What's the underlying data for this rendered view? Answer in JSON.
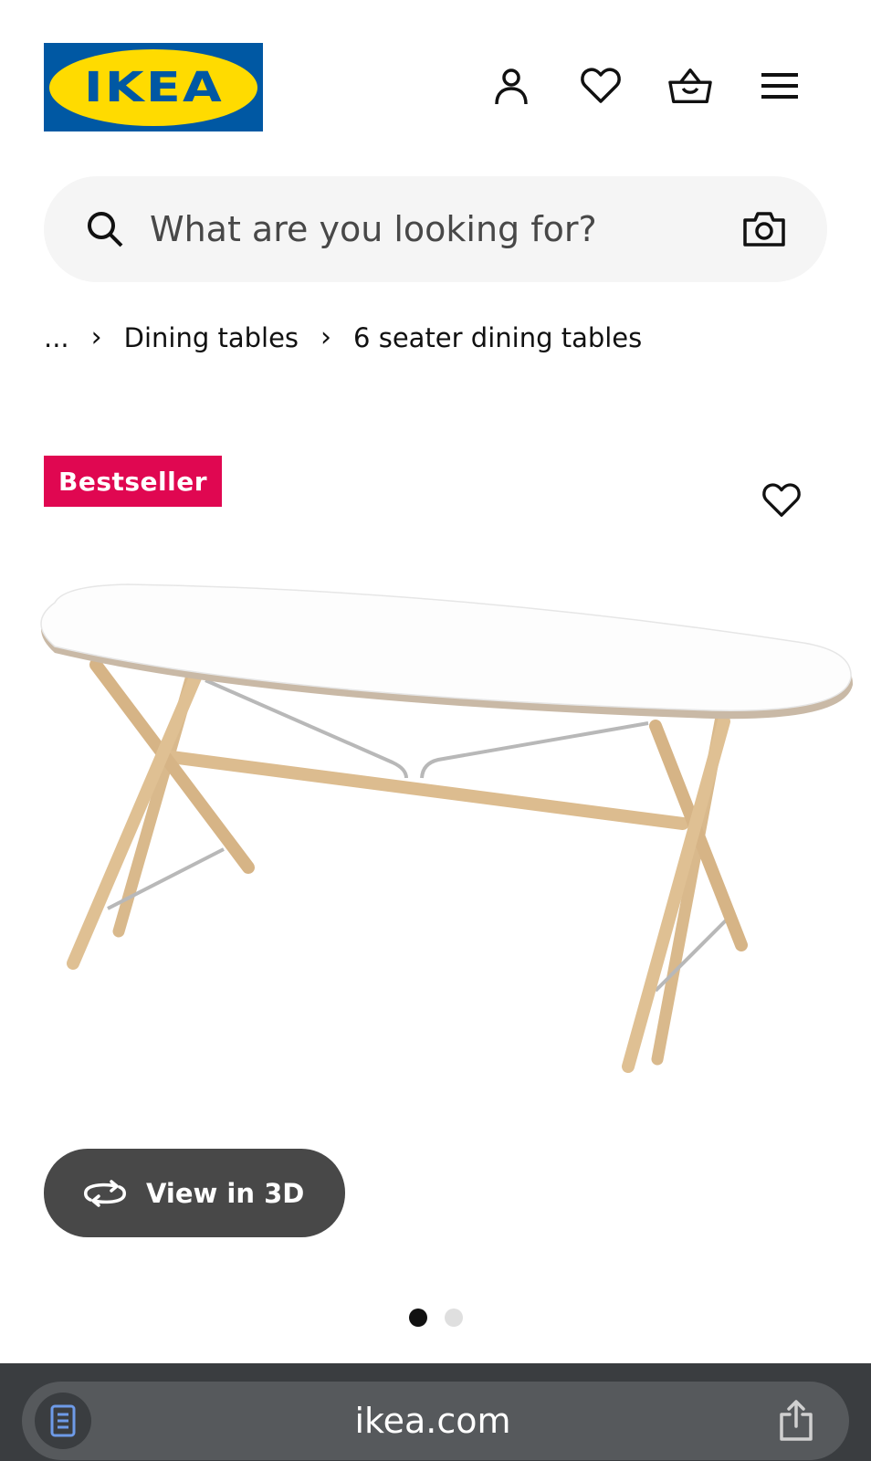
{
  "header": {
    "logo_text": "IKEA",
    "icons": [
      "user-icon",
      "heart-icon",
      "basket-icon",
      "menu-icon"
    ]
  },
  "search": {
    "placeholder": "What are you looking for?",
    "icons": [
      "search-icon",
      "camera-icon"
    ]
  },
  "breadcrumb": {
    "ellipsis": "...",
    "separator": "›",
    "items": [
      "Dining tables",
      "6 seater dining tables"
    ]
  },
  "product": {
    "badge": "Bestseller",
    "view3d_label": "View in 3D",
    "carousel": {
      "total": 2,
      "active_index": 0
    }
  },
  "browser": {
    "url": "ikea.com"
  },
  "colors": {
    "ikea_blue": "#0058A3",
    "ikea_yellow": "#FFDB00",
    "badge_red": "#E00751",
    "search_bg": "#F5F5F5",
    "view3d_bg": "#484848",
    "browser_bg": "#3A3D40",
    "reader_icon": "#6E9BE8"
  }
}
